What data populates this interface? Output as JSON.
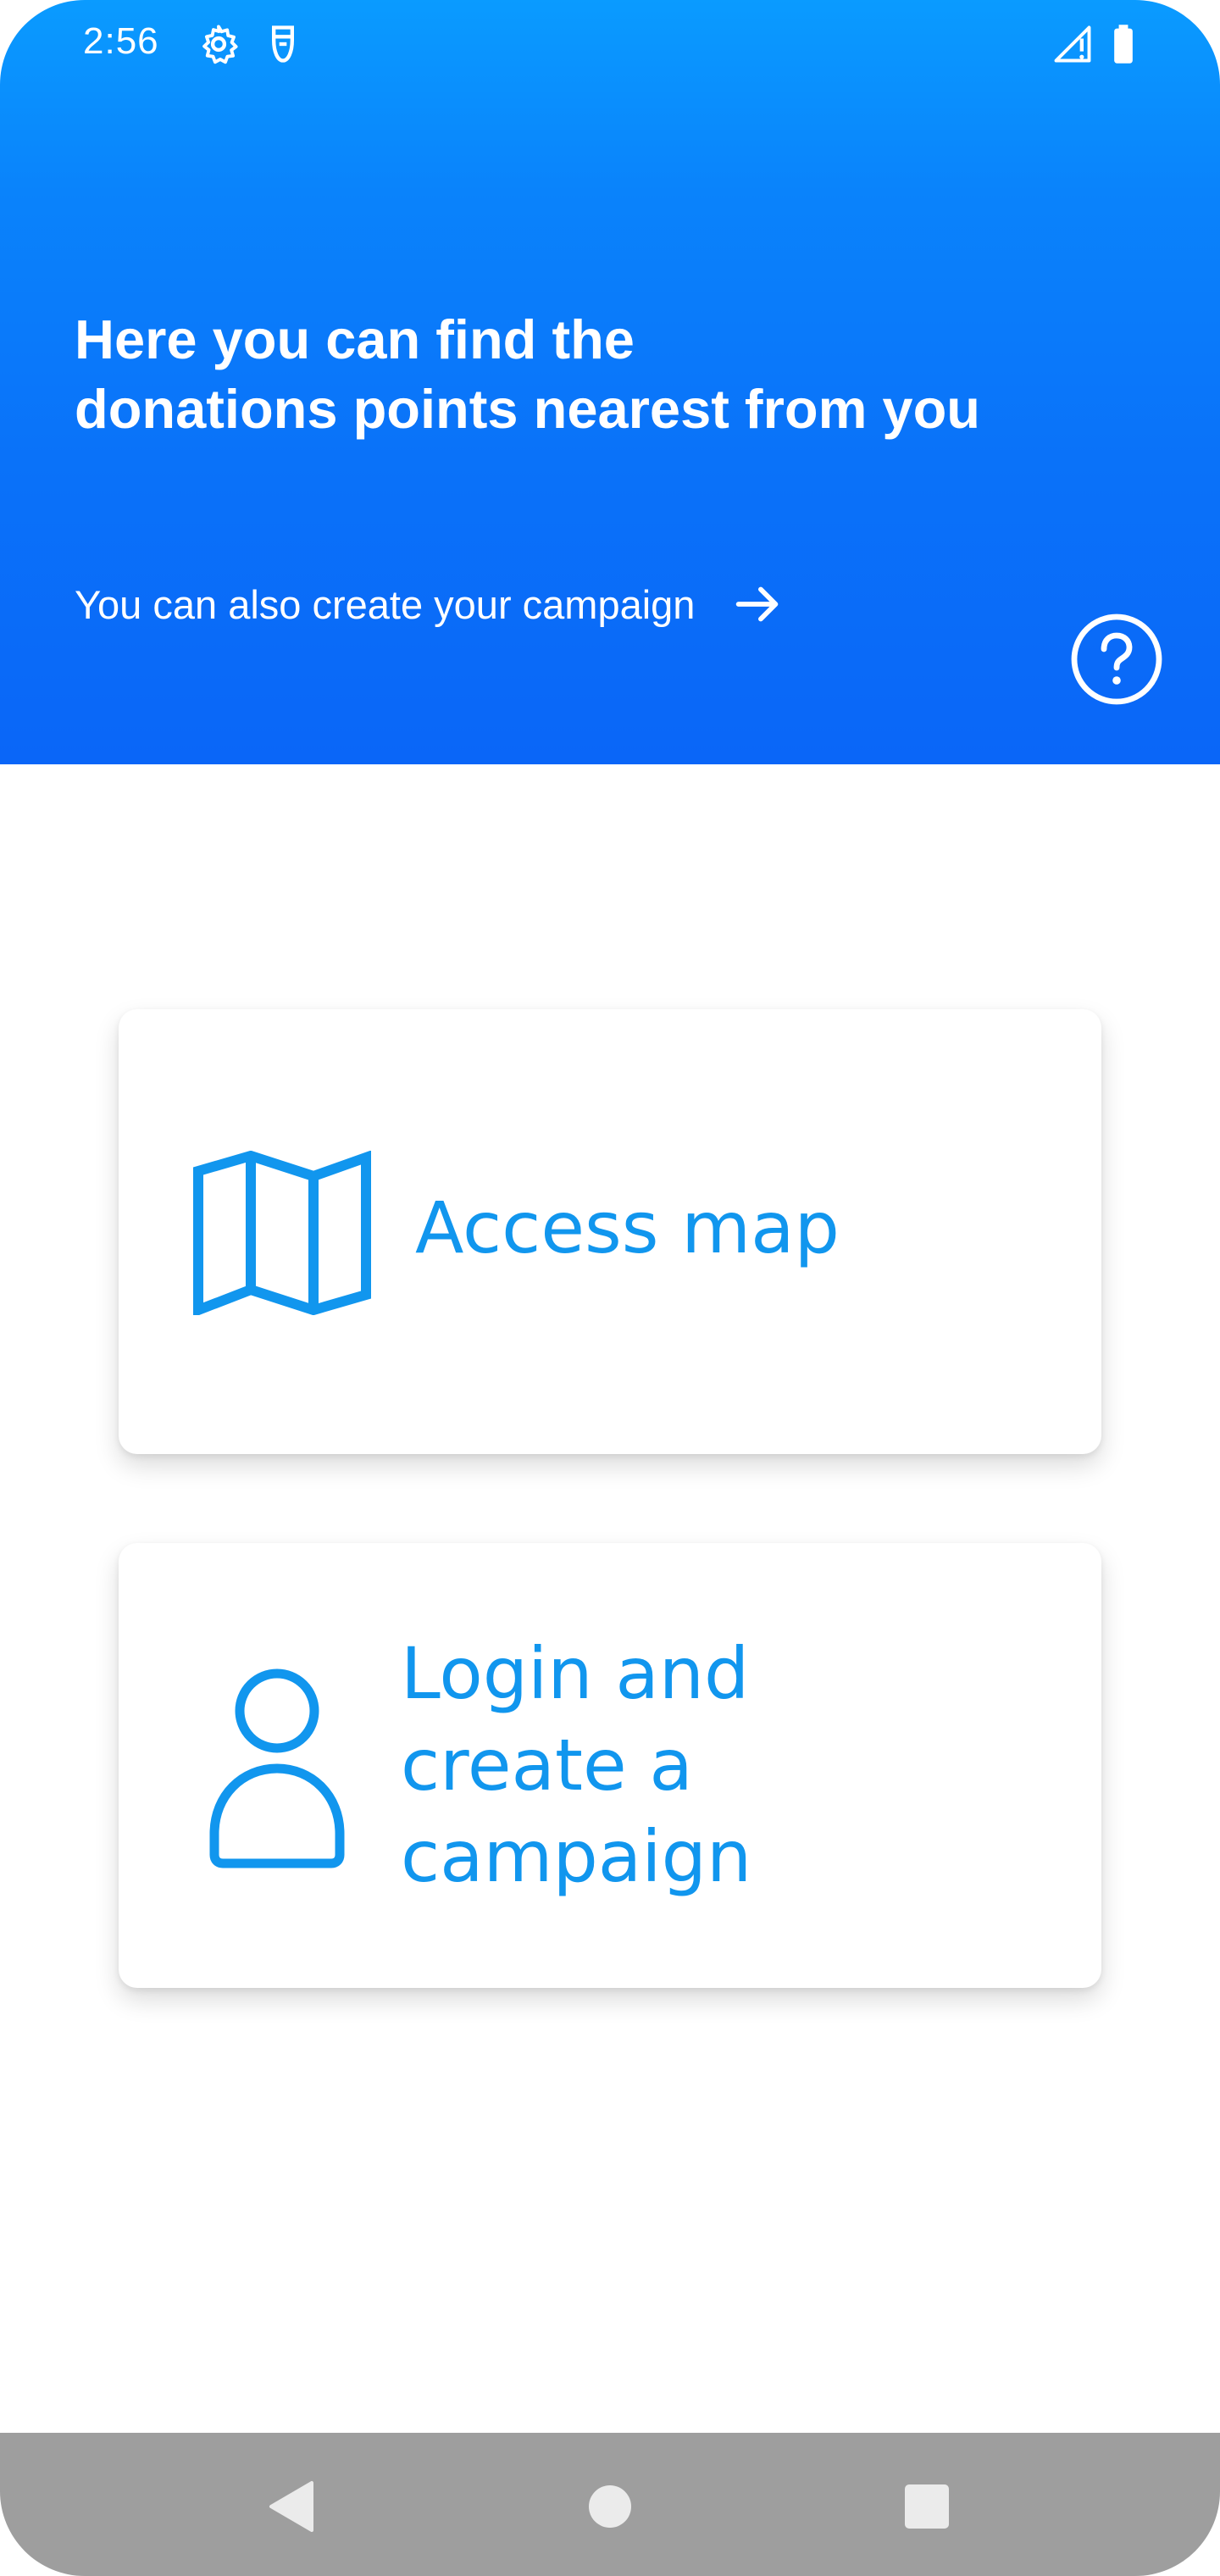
{
  "status_bar": {
    "time": "2:56",
    "icons": [
      "gear-icon",
      "sim-card-icon",
      "signal-icon",
      "battery-icon"
    ]
  },
  "hero": {
    "title_line1": "Here you can find the",
    "title_line2": "donations points nearest from you",
    "campaign_link": "You can also create your campaign",
    "link_icon": "arrow-right-icon",
    "help_icon": "question-circle-icon"
  },
  "cards": {
    "map": {
      "label": "Access map",
      "icon": "map-icon"
    },
    "login": {
      "label": "Login and create a campaign",
      "icon": "user-icon"
    }
  },
  "nav": {
    "back_icon": "back-triangle-icon",
    "home_icon": "home-circle-icon",
    "recents_icon": "recents-square-icon"
  },
  "colors": {
    "hero_top": "#0a9bff",
    "hero_bottom": "#0a66f8",
    "accent": "#1196ee",
    "nav_bar": "#9e9e9e",
    "nav_icon": "#ebebeb"
  }
}
